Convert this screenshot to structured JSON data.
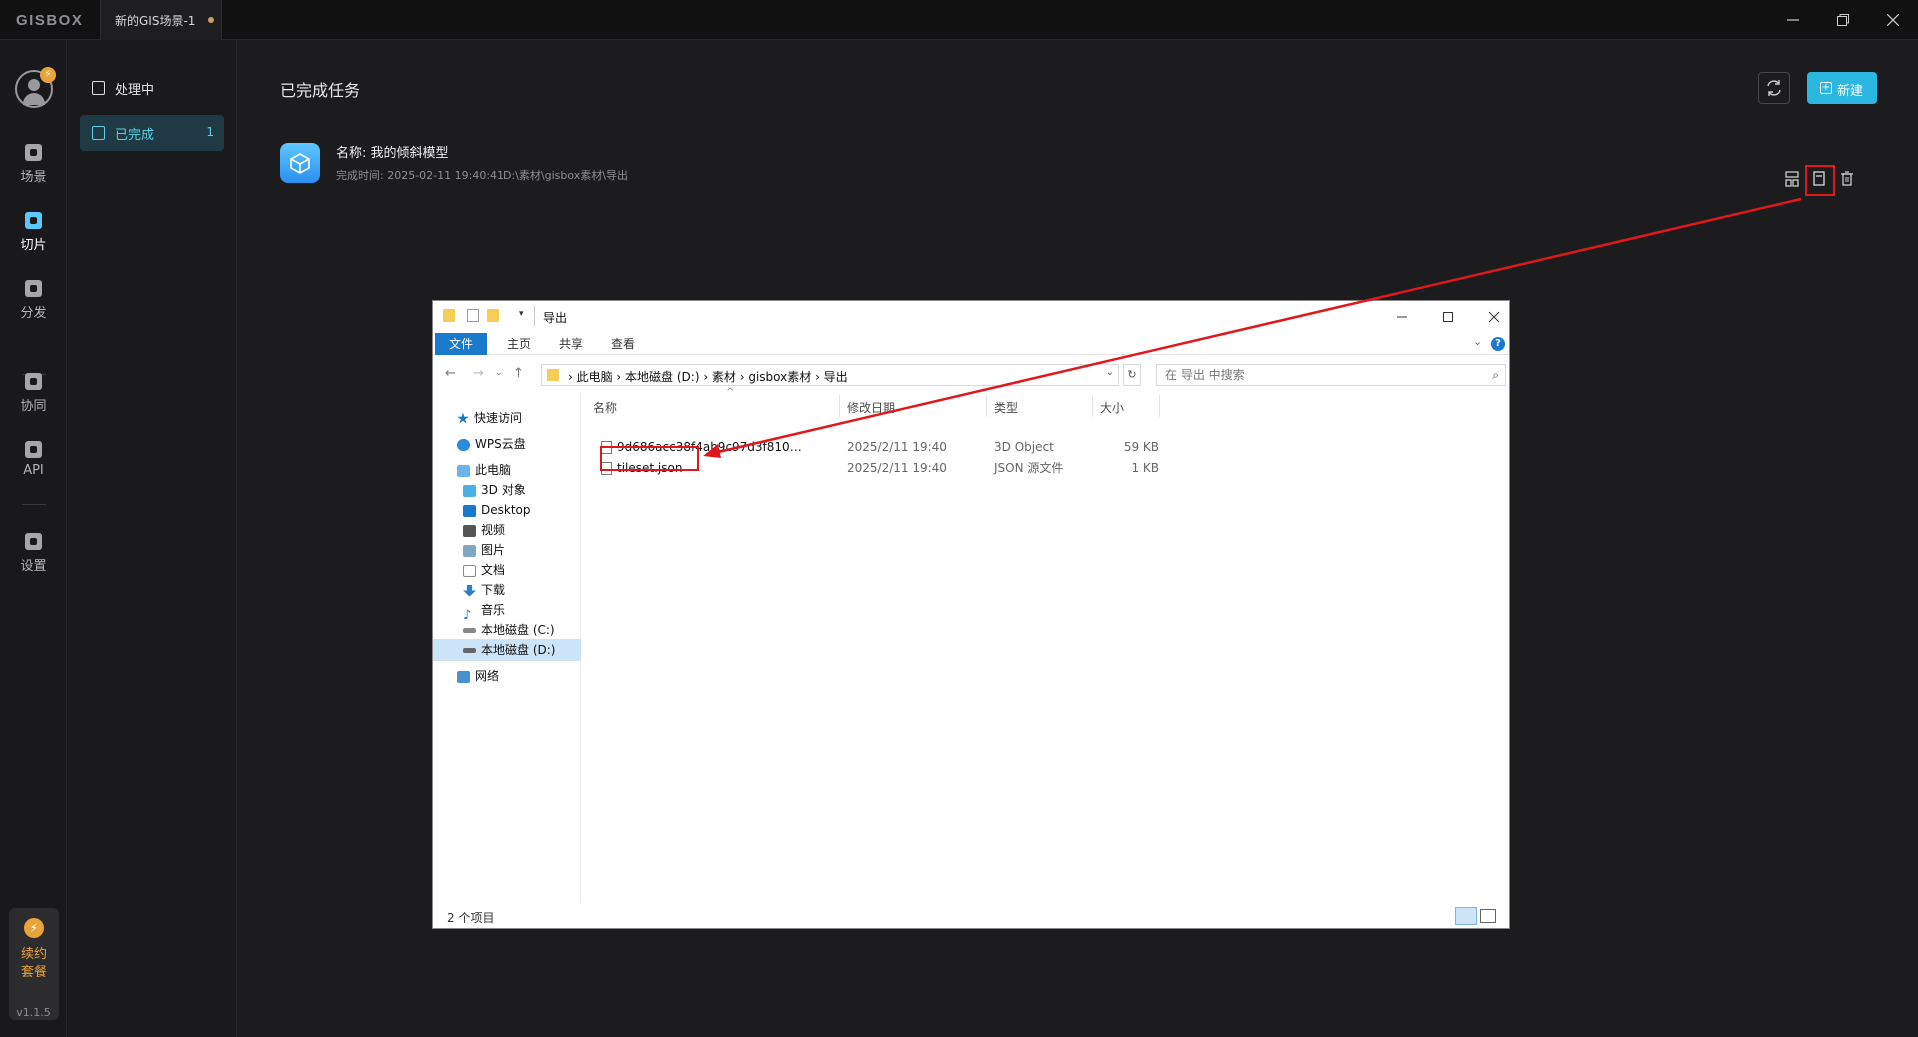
{
  "app": {
    "logo": "GISBOX",
    "document_tab": "新的GIS场景-1"
  },
  "rail": {
    "avatar_badge": "⚡",
    "items": [
      {
        "label": "场景",
        "icon": "scene-icon"
      },
      {
        "label": "切片",
        "icon": "tile-icon"
      },
      {
        "label": "分发",
        "icon": "distribute-icon"
      },
      {
        "label": "协同",
        "icon": "collab-icon"
      },
      {
        "label": "API",
        "icon": "api-icon"
      },
      {
        "label": "设置",
        "icon": "settings-icon"
      }
    ],
    "renew_label_1": "续约",
    "renew_label_2": "套餐",
    "version": "v1.1.5"
  },
  "subnav": {
    "processing": "处理中",
    "completed": "已完成",
    "completed_count": "1"
  },
  "main": {
    "title": "已完成任务",
    "new_button": "新建"
  },
  "task": {
    "name_label": "名称:  我的倾斜模型",
    "time_label": "完成时间: 2025-02-11 19:40:41",
    "path": "D:\\素材\\gisbox素材\\导出"
  },
  "explorer": {
    "title": "导出",
    "ribbon": [
      "文件",
      "主页",
      "共享",
      "查看"
    ],
    "breadcrumbs": "›  此电脑  ›  本地磁盘 (D:)  ›  素材  ›  gisbox素材  ›  导出",
    "search_placeholder": "在 导出 中搜索",
    "sidebar": {
      "quick_access": "快速访问",
      "wps": "WPS云盘",
      "this_pc": "此电脑",
      "objects3d": "3D 对象",
      "desktop": "Desktop",
      "videos": "视频",
      "pictures": "图片",
      "documents": "文档",
      "downloads": "下载",
      "music": "音乐",
      "drive_c": "本地磁盘 (C:)",
      "drive_d": "本地磁盘 (D:)",
      "network": "网络"
    },
    "columns": {
      "name": "名称",
      "modified": "修改日期",
      "type": "类型",
      "size": "大小"
    },
    "files": [
      {
        "name": "9d686acc38f4ab9c97d3f8107764b70...",
        "modified": "2025/2/11 19:40",
        "type": "3D Object",
        "size": "59 KB"
      },
      {
        "name": "tileset.json",
        "modified": "2025/2/11 19:40",
        "type": "JSON 源文件",
        "size": "1 KB"
      }
    ],
    "status": "2 个项目"
  },
  "colors": {
    "accent": "#2ab7e0",
    "highlight": "#e0171c",
    "badge": "#e8a33c"
  }
}
